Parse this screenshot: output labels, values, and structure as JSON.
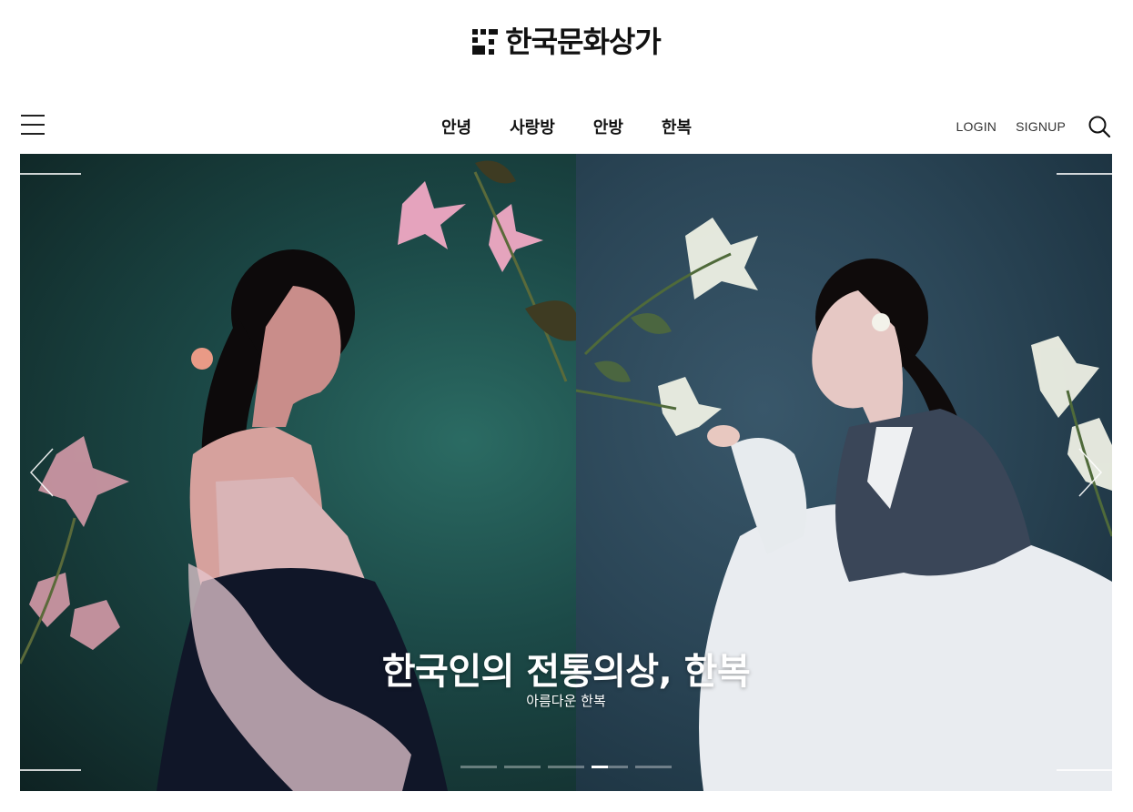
{
  "logo": {
    "text": "한국문화상가"
  },
  "nav": {
    "items": [
      "안녕",
      "사랑방",
      "안방",
      "한복"
    ]
  },
  "auth": {
    "login": "LOGIN",
    "signup": "SIGNUP"
  },
  "hero": {
    "title": "한국인의 전통의상, 한복",
    "subtitle": "아름다운 한복",
    "slide_count": 5,
    "active_slide": 4
  },
  "icons": {
    "menu": "hamburger-icon",
    "search": "search-icon",
    "prev": "chevron-left-icon",
    "next": "chevron-right-icon"
  },
  "colors": {
    "text": "#111111",
    "hero_left": "#1c4a48",
    "hero_right": "#2b4657"
  }
}
